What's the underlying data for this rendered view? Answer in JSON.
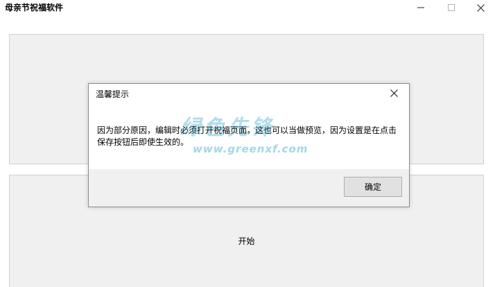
{
  "window": {
    "title": "母亲节祝福软件",
    "controls": [
      "minimize-icon",
      "maximize-icon",
      "close-icon"
    ]
  },
  "main": {
    "start_label": "开始"
  },
  "dialog": {
    "title": "温馨提示",
    "message": "因为部分原因，编辑时必须打开祝福页面，这也可以当做预览，因为设置是在点击保存按钮后即使生效的。",
    "ok_label": "确定",
    "close_icon": "close-icon"
  },
  "watermark": {
    "line1": "绿色先锋",
    "line2": "www.greenxf.com"
  },
  "colors": {
    "panel_background": "#f0f0f0",
    "dialog_footer": "#f0f0f0",
    "button_background": "#e1e1e1",
    "watermark": "#008cbe"
  }
}
